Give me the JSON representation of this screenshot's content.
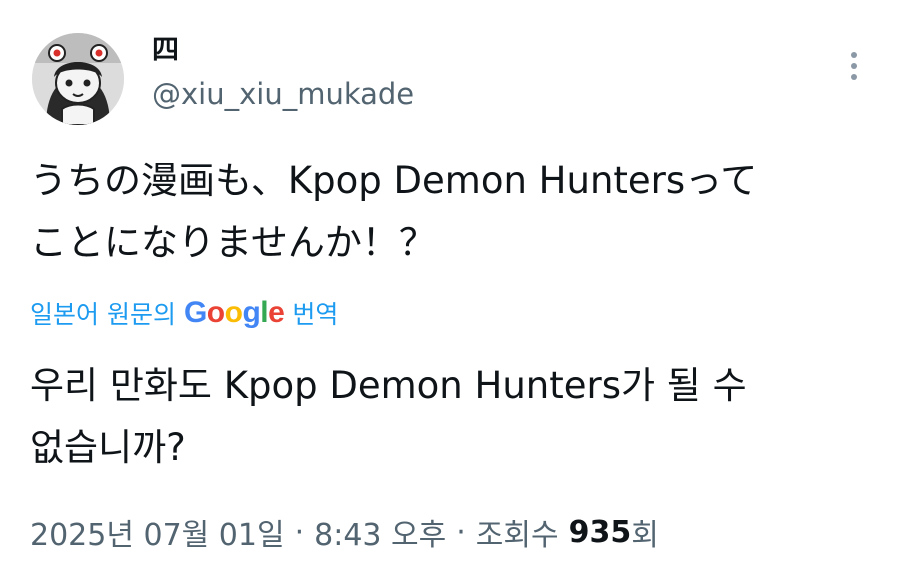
{
  "author": {
    "display_name": "四",
    "handle": "@xiu_xiu_mukade"
  },
  "icons": {
    "avatar": "anime-character-avatar",
    "more": "more-vertical-icon"
  },
  "tweet": {
    "text": "うちの漫画も、Kpop Demon Huntersって\nことになりませんか！？"
  },
  "translation": {
    "prefix": "일본어 원문의",
    "brand": "Google",
    "suffix": "번역",
    "text": "우리 만화도 Kpop Demon Hunters가 될 수\n없습니까?"
  },
  "meta": {
    "date": "2025년 07월 01일",
    "time": "8:43 오후",
    "views_label": "조회수",
    "views_count": "935",
    "views_unit": "회",
    "separator": "·"
  },
  "colors": {
    "text": "#0f1419",
    "secondary": "#536471",
    "link": "#1d9bf0",
    "google_blue": "#4285F4",
    "google_red": "#EA4335",
    "google_yellow": "#FBBC05",
    "google_green": "#34A853"
  }
}
